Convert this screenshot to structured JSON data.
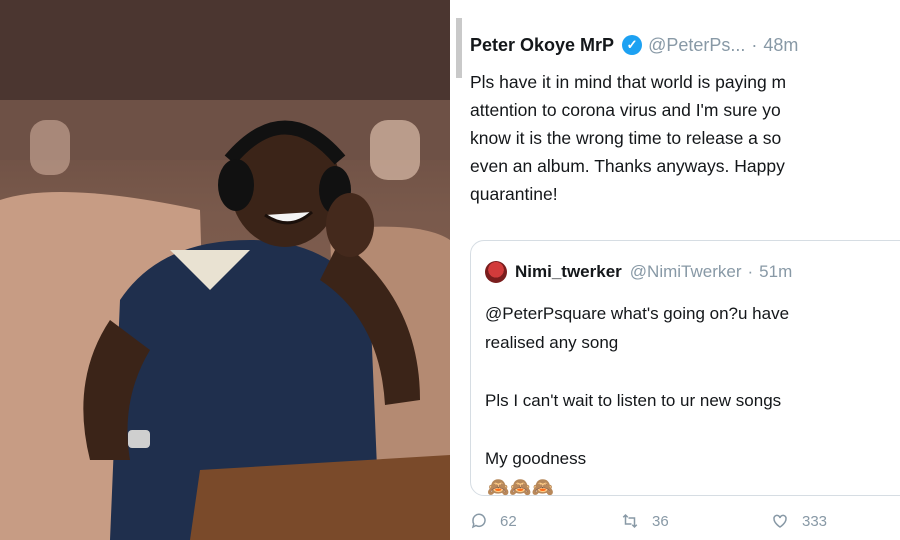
{
  "photo": {
    "subject": "man-wearing-headphones-on-plane"
  },
  "tweet": {
    "author_name": "Peter Okoye MrP",
    "handle": "@PeterPs...",
    "time": "48m",
    "text_lines": [
      "Pls have it in mind that world is paying m",
      "attention to corona virus and I'm sure yo",
      "know it is the wrong time to release a so",
      "even an album. Thanks anyways. Happy",
      "quarantine!"
    ],
    "quoted": {
      "name": "Nimi_twerker",
      "handle": "@NimiTwerker",
      "time": "51m",
      "lines": [
        "@PeterPsquare what's going on?u have",
        "realised any song",
        "Pls I can't wait to listen to ur new songs",
        "My goodness"
      ],
      "emoji": "🙈🙈🙈"
    },
    "actions": {
      "replies": "62",
      "retweets": "36",
      "likes": "333"
    }
  },
  "colors": {
    "verified_blue": "#1da1f2",
    "muted_text": "#8899a6"
  }
}
